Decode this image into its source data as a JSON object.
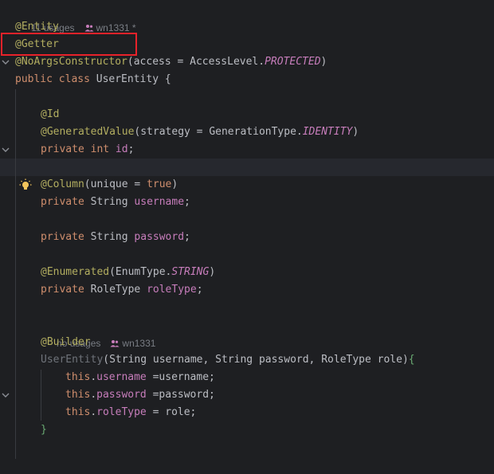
{
  "colors": {
    "background": "#1e1f22",
    "current_line": "#26282e",
    "annotation": "#b3ae60",
    "keyword": "#cf8e6d",
    "field": "#c77dbb",
    "plain_text": "#bcbec4",
    "hint_text": "#7a7e85",
    "highlight_box": "#e8222a"
  },
  "hints": {
    "class_usages": "11 usages",
    "class_author": "wn1331 *",
    "ctor_usages": "no usages",
    "ctor_author": "wn1331"
  },
  "code": {
    "l1": {
      "ann": "@Entity"
    },
    "l2": {
      "ann": "@Getter"
    },
    "l3": {
      "ann": "@NoArgsConstructor",
      "open": "(access = AccessLevel.",
      "const": "PROTECTED",
      "close": ")"
    },
    "l4": {
      "kw": "public class",
      "name": " UserEntity {"
    },
    "l5": {
      "ann": "@Id"
    },
    "l6": {
      "ann": "@GeneratedValue",
      "open": "(strategy = GenerationType.",
      "const": "IDENTITY",
      "close": ")"
    },
    "l7": {
      "kw": "private int",
      "field": " id",
      "end": ";"
    },
    "l8": {
      "ann": "@Column",
      "open": "(unique = ",
      "kw": "true",
      "close": ")"
    },
    "l9": {
      "kw": "private",
      "type": " String",
      "field": " username",
      "end": ";"
    },
    "l10": {
      "kw": "private",
      "type": " String",
      "field": " password",
      "end": ";"
    },
    "l11": {
      "ann": "@Enumerated",
      "open": "(EnumType.",
      "const": "STRING",
      "close": ")"
    },
    "l12": {
      "kw": "private",
      "type": " RoleType",
      "field": " roleType",
      "end": ";"
    },
    "l13": {
      "ann": "@Builder"
    },
    "l14": {
      "name": "UserEntity",
      "params": "(String username, String password, RoleType role)",
      "brace": "{"
    },
    "l15": {
      "kw": "this",
      "dot": ".",
      "field": "username",
      "rest": " =username;"
    },
    "l16": {
      "kw": "this",
      "dot": ".",
      "field": "password",
      "rest": " =password;"
    },
    "l17": {
      "kw": "this",
      "dot": ".",
      "field": "roleType",
      "rest": " = role;"
    },
    "l18": {
      "brace": "}"
    }
  },
  "icons": {
    "fold": "chevron-down-icon",
    "bulb": "lightbulb-icon",
    "user": "user-icon"
  }
}
